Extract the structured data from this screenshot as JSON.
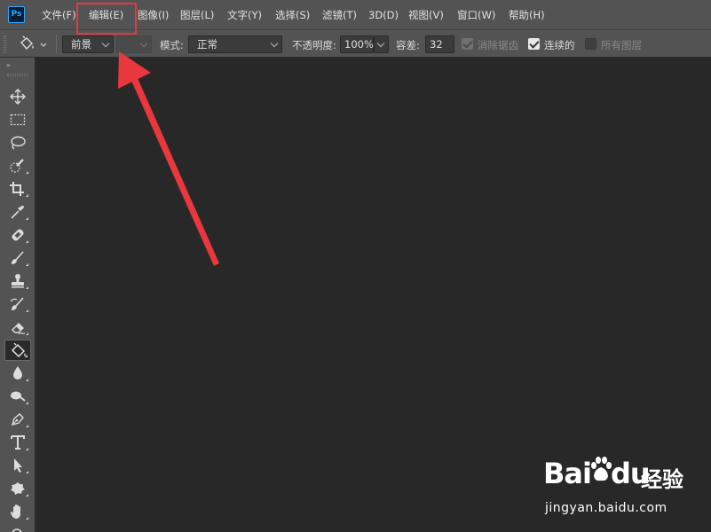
{
  "app": {
    "logo_text": "Ps",
    "accent_color": "#31a8ff"
  },
  "menubar": {
    "items": [
      {
        "label": "文件(F)"
      },
      {
        "label": "编辑(E)"
      },
      {
        "label": "图像(I)"
      },
      {
        "label": "图层(L)"
      },
      {
        "label": "文字(Y)"
      },
      {
        "label": "选择(S)"
      },
      {
        "label": "滤镜(T)"
      },
      {
        "label": "3D(D)"
      },
      {
        "label": "视图(V)"
      },
      {
        "label": "窗口(W)"
      },
      {
        "label": "帮助(H)"
      }
    ],
    "highlighted_item": "编辑(E)",
    "highlight_color": "#e8383d"
  },
  "options_bar": {
    "tool_preset_icon": "paint-bucket-icon",
    "fill_source": "前景",
    "pattern_value": "",
    "mode_label": "模式:",
    "mode_value": "正常",
    "opacity_label": "不透明度:",
    "opacity_value": "100%",
    "tolerance_label": "容差:",
    "tolerance_value": "32",
    "anti_alias_label": "消除锯齿",
    "anti_alias_checked": true,
    "anti_alias_enabled": false,
    "contiguous_label": "连续的",
    "contiguous_checked": true,
    "all_layers_label": "所有图层",
    "all_layers_checked": false,
    "all_layers_enabled": false
  },
  "toolbar": {
    "collapse_glyph": "»",
    "tools": [
      {
        "name": "move-tool",
        "icon": "move-icon"
      },
      {
        "name": "marquee-tool",
        "icon": "rectangular-marquee-icon"
      },
      {
        "name": "lasso-tool",
        "icon": "lasso-icon"
      },
      {
        "name": "quick-selection-tool",
        "icon": "quick-selection-icon"
      },
      {
        "name": "crop-tool",
        "icon": "crop-icon"
      },
      {
        "name": "eyedropper-tool",
        "icon": "eyedropper-icon"
      },
      {
        "name": "healing-brush-tool",
        "icon": "bandage-icon"
      },
      {
        "name": "brush-tool",
        "icon": "brush-icon"
      },
      {
        "name": "clone-stamp-tool",
        "icon": "stamp-icon"
      },
      {
        "name": "history-brush-tool",
        "icon": "history-brush-icon"
      },
      {
        "name": "eraser-tool",
        "icon": "eraser-icon"
      },
      {
        "name": "paint-bucket-tool",
        "icon": "paint-bucket-icon",
        "active": true
      },
      {
        "name": "blur-tool",
        "icon": "water-drop-icon"
      },
      {
        "name": "dodge-tool",
        "icon": "dodge-icon"
      },
      {
        "name": "pen-tool",
        "icon": "pen-icon"
      },
      {
        "name": "type-tool",
        "icon": "type-icon"
      },
      {
        "name": "path-selection-tool",
        "icon": "arrow-cursor-icon"
      },
      {
        "name": "custom-shape-tool",
        "icon": "custom-shape-icon"
      },
      {
        "name": "hand-tool",
        "icon": "hand-icon"
      },
      {
        "name": "zoom-tool",
        "icon": "zoom-icon"
      }
    ]
  },
  "annotation": {
    "arrow_color": "#e8383d"
  },
  "watermark": {
    "brand": "Bai",
    "brand_tail": "du",
    "suffix": "经验",
    "url": "jingyan.baidu.com"
  }
}
